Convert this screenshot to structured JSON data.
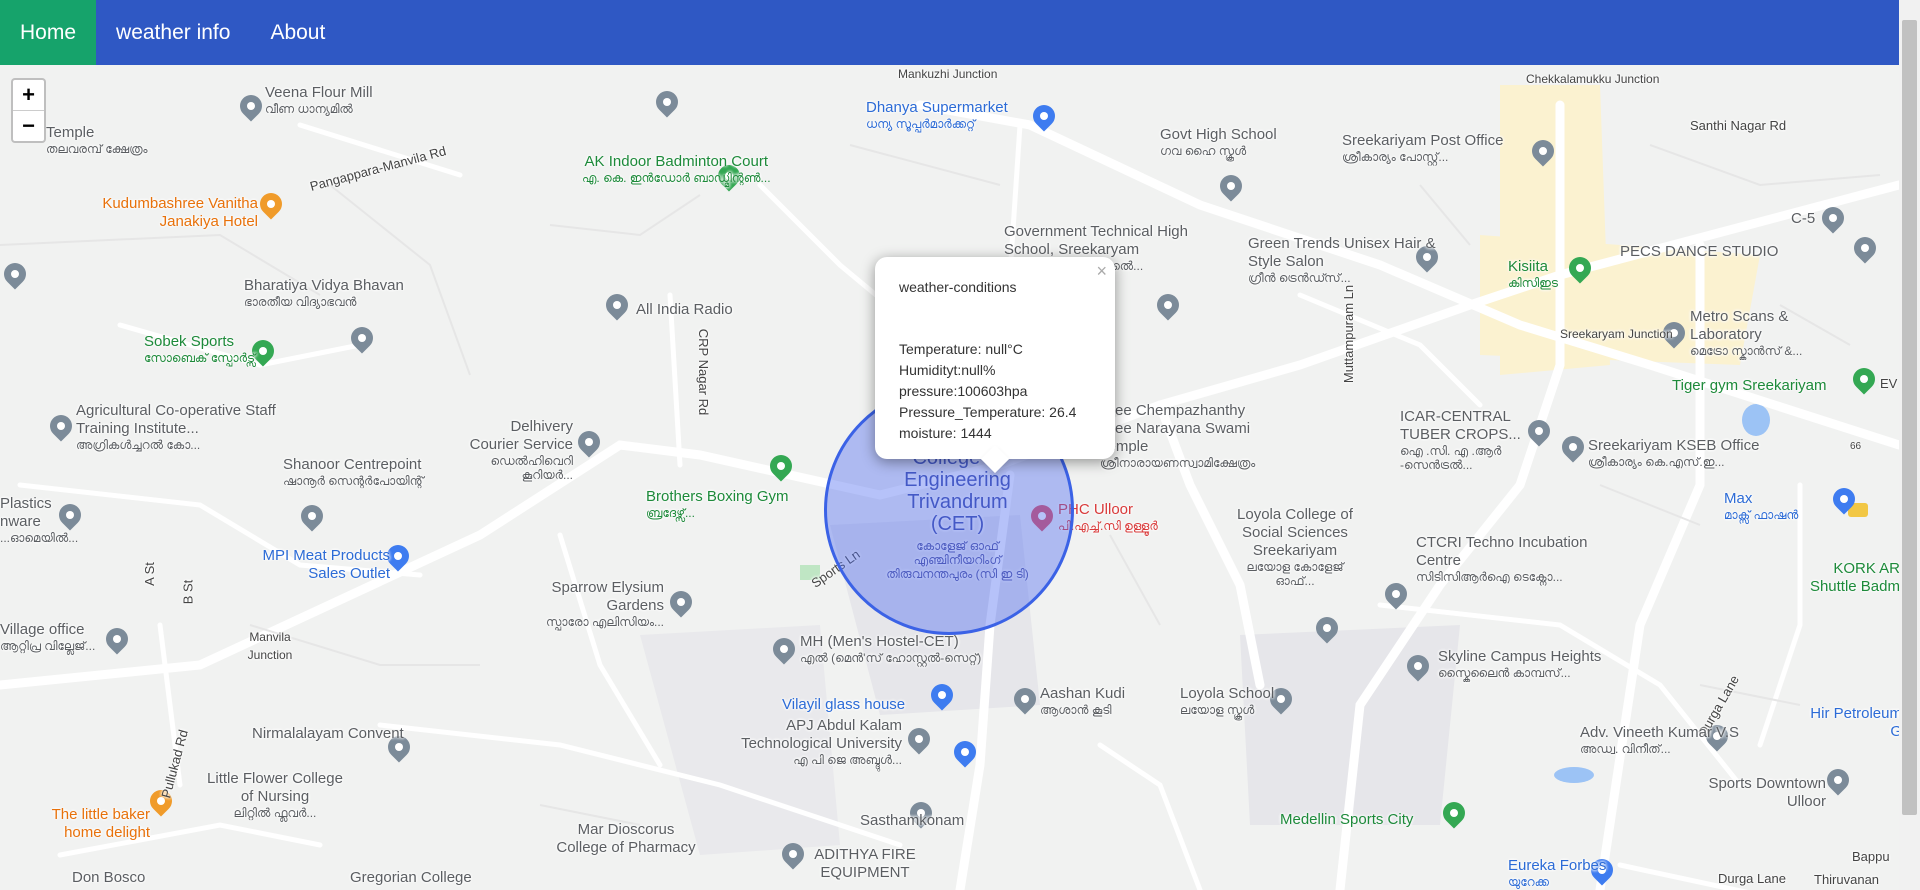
{
  "nav": {
    "items": [
      {
        "label": "Home",
        "active": true
      },
      {
        "label": "weather info",
        "active": false
      },
      {
        "label": "About",
        "active": false
      }
    ]
  },
  "zoom": {
    "in": "+",
    "out": "−"
  },
  "popup": {
    "title": "weather-conditions",
    "close": "×",
    "lines": [
      "Temperature: null°C",
      "Humidityt:null%",
      "pressure:100603hpa",
      "Pressure_Temperature: 26.4",
      "moisture: 1444"
    ]
  },
  "places": [
    {
      "name": "Veena Flour Mill",
      "sub": "വീണ ധാന്യമിൽ",
      "color": "gray"
    },
    {
      "name": "Temple",
      "sub": "തലവരമ്പ് ക്ഷേത്രം",
      "color": "gray"
    },
    {
      "name": "Pangappara-Manvila Rd",
      "sub": "",
      "color": "dark"
    },
    {
      "name": "AK Indoor Badminton Court",
      "sub": "എ. കെ. ഇൻഡോർ ബാഡ്മിന്റൺ...",
      "color": "green"
    },
    {
      "name": "Mankuzhi Junction",
      "sub": "",
      "color": "dark"
    },
    {
      "name": "Dhanya Supermarket",
      "sub": "ധന്യ സൂപ്പർമാർക്കറ്റ്",
      "color": "blue"
    },
    {
      "name": "Govt High School",
      "sub": "ഗവ ഹൈ സ്കൂൾ",
      "color": "gray"
    },
    {
      "name": "Sreekariyam Post Office",
      "sub": "ശ്രീകാര്യം പോസ്റ്റ്...",
      "color": "gray"
    },
    {
      "name": "Chekkalamukku Junction",
      "sub": "",
      "color": "dark"
    },
    {
      "name": "Santhi Nagar Rd",
      "sub": "",
      "color": "dark"
    },
    {
      "name": "Kudumbashree Vanitha Janakiya Hotel",
      "sub": "",
      "color": "orange"
    },
    {
      "name": "Government Technical High School, Sreekaryam",
      "sub": "ഗവൺമെന്റ് ടെക്നിക്കൽ...",
      "color": "gray"
    },
    {
      "name": "Green Trends Unisex Hair & Style Salon",
      "sub": "ഗ്രീൻ ട്രെൻഡ്സ്...",
      "color": "gray"
    },
    {
      "name": "C-5",
      "sub": "",
      "color": "gray"
    },
    {
      "name": "PECS DANCE STUDIO",
      "sub": "",
      "color": "gray"
    },
    {
      "name": "Bharatiya Vidya Bhavan",
      "sub": "ഭാരതീയ വിദ്യാഭവൻ",
      "color": "gray"
    },
    {
      "name": "All India Radio",
      "sub": "",
      "color": "gray"
    },
    {
      "name": "Kisiita",
      "sub": "കിസിഇട",
      "color": "green"
    },
    {
      "name": "Sobek Sports",
      "sub": "സോബെക് സ്പോർട്സ്",
      "color": "green"
    },
    {
      "name": "CRP Nagar Rd",
      "sub": "",
      "color": "dark"
    },
    {
      "name": "Sreekaryam Junction",
      "sub": "",
      "color": "dark"
    },
    {
      "name": "Metro Scans & Laboratory",
      "sub": "മെട്രോ സ്കാൻസ് &...",
      "color": "gray"
    },
    {
      "name": "Tiger gym Sreekariyam",
      "sub": "",
      "color": "green"
    },
    {
      "name": "Agricultural Co-operative Staff Training Institute...",
      "sub": "അഗ്രികൾച്ചറൽ കോ...",
      "color": "gray"
    },
    {
      "name": "Delhivery Courier Service",
      "sub": "ഡെൽഹിവെറി കൂറിയർ...",
      "color": "gray"
    },
    {
      "name": "Sree Chempazhanthy Sree Narayana Swami Temple",
      "sub": "ശ്രീനാരായണസ്വാമിക്ഷേത്രം",
      "color": "gray"
    },
    {
      "name": "Muttampuram Ln",
      "sub": "",
      "color": "dark"
    },
    {
      "name": "ICAR-CENTRAL TUBER CROPS...",
      "sub": "ഐ .സി. എ .ആർ -സെൻട്രൽ...",
      "color": "gray"
    },
    {
      "name": "Sreekariyam KSEB Office",
      "sub": "ശ്രീകാര്യം കെ.എസ്.ഇ...",
      "color": "gray"
    },
    {
      "name": "Shanoor Centrepoint",
      "sub": "ഷാനൂർ സെന്റർപോയിന്റ്",
      "color": "gray"
    },
    {
      "name": "Brothers Boxing Gym",
      "sub": "ബ്രദേഴ്സ്...",
      "color": "green"
    },
    {
      "name": "College of Engineering Trivandrum (CET)",
      "sub": "കോളേജ് ഓഫ് എഞ്ചിനീയറിംഗ് തിരുവനന്തപുരം (സി ഇ ടി)",
      "color": "cet"
    },
    {
      "name": "PHC Ulloor",
      "sub": "പി.എച്ച്.സി ഉള്ളൂർ",
      "color": "red"
    },
    {
      "name": "Loyola College of Social Sciences Sreekariyam",
      "sub": "ലയോള കോളേജ് ഓഫ്...",
      "color": "gray"
    },
    {
      "name": "Max",
      "sub": "മാക്സ് ഫാഷൻ",
      "color": "blue"
    },
    {
      "name": "Plastics nware",
      "sub": "...ഓമെയിൽ...",
      "color": "gray"
    },
    {
      "name": "MPI Meat Products Sales Outlet",
      "sub": "",
      "color": "blue"
    },
    {
      "name": "A St",
      "sub": "",
      "color": "dark"
    },
    {
      "name": "B St",
      "sub": "",
      "color": "dark"
    },
    {
      "name": "Sports Ln",
      "sub": "",
      "color": "dark"
    },
    {
      "name": "CTCRI Techno Incubation Centre",
      "sub": "സിടിസിആർഐ ടെക്നോ...",
      "color": "gray"
    },
    {
      "name": "KORK AR Shuttle Badm",
      "sub": "",
      "color": "green"
    },
    {
      "name": "Sparrow Elysium Gardens",
      "sub": "സ്പാരോ എലിസിയം...",
      "color": "gray"
    },
    {
      "name": "Village office",
      "sub": "ആറ്റിപ്ര വില്ലേജ്...",
      "color": "gray"
    },
    {
      "name": "Manvila Junction",
      "sub": "",
      "color": "dark"
    },
    {
      "name": "MH (Men's Hostel-CET)",
      "sub": "എൽ (മെൻ'സ് ഹോസ്റ്റൽ-സെറ്റ്)",
      "color": "gray"
    },
    {
      "name": "Skyline Campus Heights",
      "sub": "സ്കൈലൈൻ കാമ്പസ്...",
      "color": "gray"
    },
    {
      "name": "Aashan Kudi",
      "sub": "ആശാൻ കൂടി",
      "color": "gray"
    },
    {
      "name": "Loyola School",
      "sub": "ലയോള സ്കൂൾ",
      "color": "gray"
    },
    {
      "name": "Vilayil glass house",
      "sub": "",
      "color": "blue"
    },
    {
      "name": "Pullukad Rd",
      "sub": "",
      "color": "dark"
    },
    {
      "name": "Nirmalalayam Convent",
      "sub": "",
      "color": "gray"
    },
    {
      "name": "APJ Abdul Kalam Technological University",
      "sub": "എ പി ജെ അബ്ദുൾ...",
      "color": "gray"
    },
    {
      "name": "Durga Lane",
      "sub": "",
      "color": "dark"
    },
    {
      "name": "Adv. Vineeth Kumar V.S",
      "sub": "അഡ്വ. വിനീത്...",
      "color": "gray"
    },
    {
      "name": "Hir Petroleum G",
      "sub": "",
      "color": "blue"
    },
    {
      "name": "Little Flower College of Nursing",
      "sub": "ലിറ്റിൽ ഫ്ലവർ...",
      "color": "gray"
    },
    {
      "name": "Sports Downtown Ulloor",
      "sub": "",
      "color": "gray"
    },
    {
      "name": "The little baker home delight",
      "sub": "",
      "color": "orange"
    },
    {
      "name": "Sasthamkonam",
      "sub": "",
      "color": "gray"
    },
    {
      "name": "Medellin Sports City",
      "sub": "",
      "color": "green"
    },
    {
      "name": "Mar Dioscorus College of Pharmacy",
      "sub": "",
      "color": "gray"
    },
    {
      "name": "ADITHYA FIRE EQUIPMENT",
      "sub": "",
      "color": "gray"
    },
    {
      "name": "Eureka Forbes",
      "sub": "യുറേക്ക",
      "color": "blue"
    },
    {
      "name": "Bappu",
      "sub": "",
      "color": "dark"
    },
    {
      "name": "Thiruvanan",
      "sub": "",
      "color": "dark"
    },
    {
      "name": "Don Bosco",
      "sub": "",
      "color": "gray"
    },
    {
      "name": "Gregorian College",
      "sub": "",
      "color": "gray"
    },
    {
      "name": "Durga Lane",
      "sub": "",
      "color": "dark"
    },
    {
      "name": "66",
      "sub": "",
      "color": "dark"
    },
    {
      "name": "EV",
      "sub": "",
      "color": "dark"
    }
  ]
}
